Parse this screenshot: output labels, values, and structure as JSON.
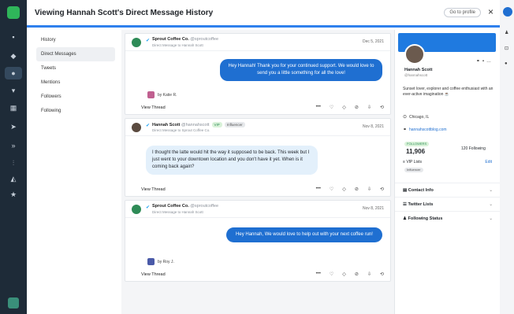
{
  "modal": {
    "title": "Viewing Hannah Scott's Direct Message History",
    "header_pill": "Go to profile",
    "close_icon": "×"
  },
  "nav": {
    "items": [
      {
        "label": "History"
      },
      {
        "label": "Direct Messages"
      },
      {
        "label": "Tweets"
      },
      {
        "label": "Mentions"
      },
      {
        "label": "Followers"
      },
      {
        "label": "Following"
      }
    ]
  },
  "messages": [
    {
      "author": "Sprout Coffee Co.",
      "handle": "@sproutcoffee",
      "sub": "Direct Message to Hannah Scott",
      "date": "Dec 5, 2021",
      "text": "Hey Hannah! Thank you for your continued support. We would love to send you a little something for all the love!",
      "byline": "by Katie R.",
      "view": "View Thread"
    },
    {
      "author": "Hannah Scott",
      "handle": "@hannahscott",
      "tag1": "VIP",
      "tag2": "Influencer",
      "sub": "Direct Message to Sprout Coffee Co.",
      "date": "Nov 8, 2021",
      "text": "I thought the latte would hit the way it supposed to be back. This week but I just went to your downtown location and you don't have it yet. When is it coming back again?",
      "view": "View Thread"
    },
    {
      "author": "Sprout Coffee Co.",
      "handle": "@sproutcoffee",
      "sub": "Direct Message to Hannah Scott",
      "date": "Nov 8, 2021",
      "text": "Hey Hannah, We would love to help out with your next coffee run!",
      "byline": "by Roy J.",
      "view": "View Thread"
    }
  ],
  "profile": {
    "name": "Hannah Scott",
    "handle": "@hannahscott",
    "bio": "Sunset lover, explorer and coffee enthusiast with an ever-active imagination ☕",
    "location": "Chicago, IL",
    "website": "hannahscottblog.com",
    "followers_tag": "FOLLOWERS",
    "followers": "11,906",
    "following": "120 Following",
    "vip": "VIP Lists",
    "edit": "Edit",
    "influencer": "Influencer",
    "sections": [
      {
        "label": "Contact Info"
      },
      {
        "label": "Twitter Lists"
      },
      {
        "label": "Following Status"
      }
    ]
  },
  "colors": {
    "accent": "#1f6fd1",
    "rail": "#1e2b38",
    "brand_green": "#2fb55a"
  }
}
